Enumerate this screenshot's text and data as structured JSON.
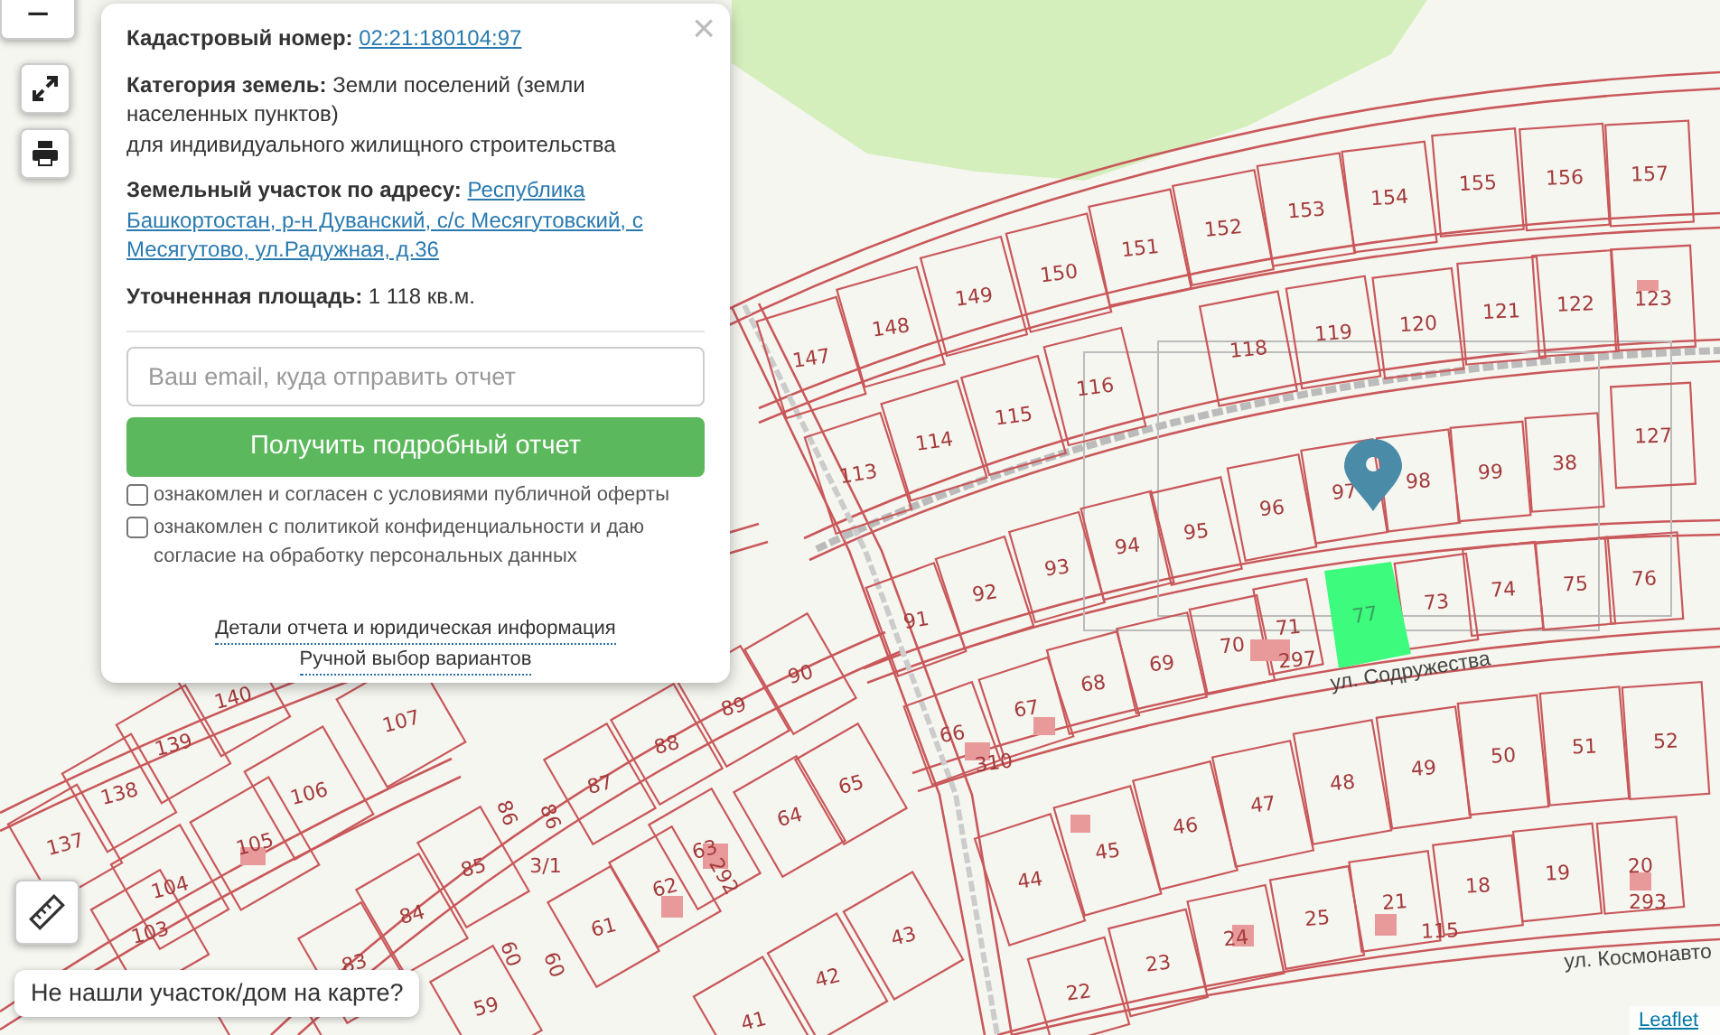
{
  "map": {
    "lots": [
      {
        "number": "147"
      },
      {
        "number": "148"
      },
      {
        "number": "149"
      },
      {
        "number": "150"
      },
      {
        "number": "151"
      },
      {
        "number": "152"
      },
      {
        "number": "153"
      },
      {
        "number": "154"
      },
      {
        "number": "155"
      },
      {
        "number": "156"
      },
      {
        "number": "157"
      },
      {
        "number": "113"
      },
      {
        "number": "114"
      },
      {
        "number": "115"
      },
      {
        "number": "116"
      },
      {
        "number": "118"
      },
      {
        "number": "119"
      },
      {
        "number": "120"
      },
      {
        "number": "121"
      },
      {
        "number": "122"
      },
      {
        "number": "123"
      },
      {
        "number": "91"
      },
      {
        "number": "92"
      },
      {
        "number": "93"
      },
      {
        "number": "94"
      },
      {
        "number": "95"
      },
      {
        "number": "96"
      },
      {
        "number": "97"
      },
      {
        "number": "98"
      },
      {
        "number": "99"
      },
      {
        "number": "38"
      },
      {
        "number": "127"
      },
      {
        "number": "68"
      },
      {
        "number": "69"
      },
      {
        "number": "70"
      },
      {
        "number": "71"
      },
      {
        "number": "73"
      },
      {
        "number": "74"
      },
      {
        "number": "75"
      },
      {
        "number": "76"
      },
      {
        "number": "297"
      },
      {
        "number": "90"
      },
      {
        "number": "89"
      },
      {
        "number": "88"
      },
      {
        "number": "87"
      },
      {
        "number": "86"
      },
      {
        "number": "86"
      },
      {
        "number": "85"
      },
      {
        "number": "3/1"
      },
      {
        "number": "84"
      },
      {
        "number": "83"
      },
      {
        "number": "59"
      },
      {
        "number": "60"
      },
      {
        "number": "60"
      },
      {
        "number": "61"
      },
      {
        "number": "62"
      },
      {
        "number": "63"
      },
      {
        "number": "292"
      },
      {
        "number": "64"
      },
      {
        "number": "65"
      },
      {
        "number": "43"
      },
      {
        "number": "42"
      },
      {
        "number": "41"
      },
      {
        "number": "140"
      },
      {
        "number": "107"
      },
      {
        "number": "139"
      },
      {
        "number": "106"
      },
      {
        "number": "138"
      },
      {
        "number": "105"
      },
      {
        "number": "137"
      },
      {
        "number": "104"
      },
      {
        "number": "103"
      },
      {
        "number": "66"
      },
      {
        "number": "67"
      },
      {
        "number": "310"
      },
      {
        "number": "44"
      },
      {
        "number": "45"
      },
      {
        "number": "46"
      },
      {
        "number": "47"
      },
      {
        "number": "48"
      },
      {
        "number": "49"
      },
      {
        "number": "50"
      },
      {
        "number": "51"
      },
      {
        "number": "52"
      },
      {
        "number": "22"
      },
      {
        "number": "23"
      },
      {
        "number": "24"
      },
      {
        "number": "25"
      },
      {
        "number": "21"
      },
      {
        "number": "18"
      },
      {
        "number": "19"
      },
      {
        "number": "20"
      },
      {
        "number": "293"
      },
      {
        "number": "115"
      }
    ],
    "selected_plot": {
      "number": "77"
    },
    "streets": [
      {
        "name": "ул. Содружества"
      },
      {
        "name": "ул. Космонавто"
      }
    ],
    "controls": {
      "zoom_out": "−"
    },
    "notice": "Не нашли участок/дом на карте?",
    "attribution": "Leaflet"
  },
  "popup": {
    "close": "×",
    "cadastral_number": {
      "label": "Кадастровый номер:",
      "value": "02:21:180104:97"
    },
    "category": {
      "label": "Категория земель:",
      "value": "Земли поселений (земли населенных пунктов)",
      "purpose": "для индивидуального жилищного строительства"
    },
    "address": {
      "label": "Земельный участок по адресу:",
      "value": "Республика Башкортостан, р-н Дуванский, с/с Месягутовский, с Месягутово, ул.Радужная, д.36"
    },
    "area": {
      "label": "Уточненная площадь:",
      "value": "1 118 кв.м."
    },
    "email": {
      "placeholder": "Ваш email, куда отправить отчет"
    },
    "submit": "Получить подробный отчет",
    "agreements": [
      {
        "checked": false,
        "parts": [
          {
            "kind": "text",
            "text": "ознакомлен и согласен с условиями "
          },
          {
            "kind": "link",
            "text": "публичной оферты"
          }
        ]
      },
      {
        "checked": false,
        "parts": [
          {
            "kind": "text",
            "text": "ознакомлен с "
          },
          {
            "kind": "link",
            "text": "политикой конфиденциальности"
          },
          {
            "kind": "text",
            "text": " и даю "
          },
          {
            "kind": "break"
          },
          {
            "kind": "link",
            "text": "согласие на обработку персональных данных"
          }
        ]
      }
    ],
    "links": [
      "Детали отчета и юридическая информация",
      "Ручной выбор вариантов"
    ]
  }
}
